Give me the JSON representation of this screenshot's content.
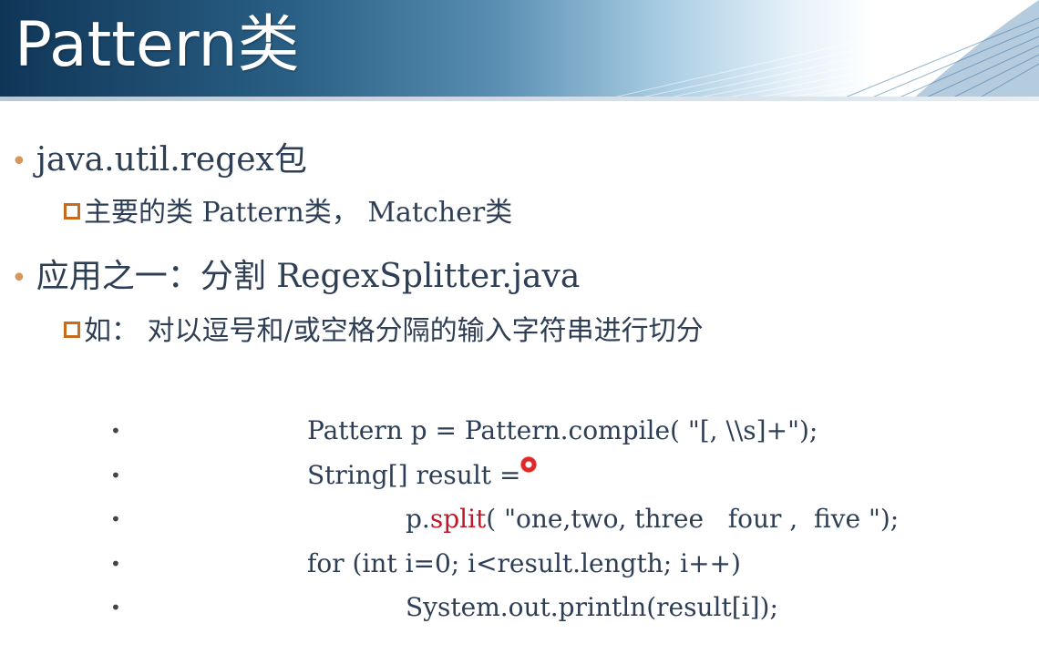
{
  "slide": {
    "title": "Pattern类",
    "bullets": [
      {
        "text": "java.util.regex包",
        "sub": "主要的类 Pattern类， Matcher类"
      },
      {
        "text": "应用之一：分割  RegexSplitter.java",
        "sub": "如： 对以逗号和/或空格分隔的输入字符串进行切分"
      }
    ],
    "code": {
      "line1": "Pattern p = Pattern.compile( \"[, \\\\s]+\");",
      "line2": "String[] result =",
      "line3_prefix": "p.",
      "line3_method": "split",
      "line3_suffix": "( \"one,two, three   four ,  five \");",
      "line4": "for (int i=0; i<result.length; i++)",
      "line5": "System.out.println(result[i]);"
    },
    "bullet_char": "•",
    "colors": {
      "header_dark": "#0f3657",
      "text": "#2d3e55",
      "bullet_accent": "#d6975b",
      "square_bullet": "#c86b1c",
      "highlight_red": "#c0182b"
    }
  }
}
